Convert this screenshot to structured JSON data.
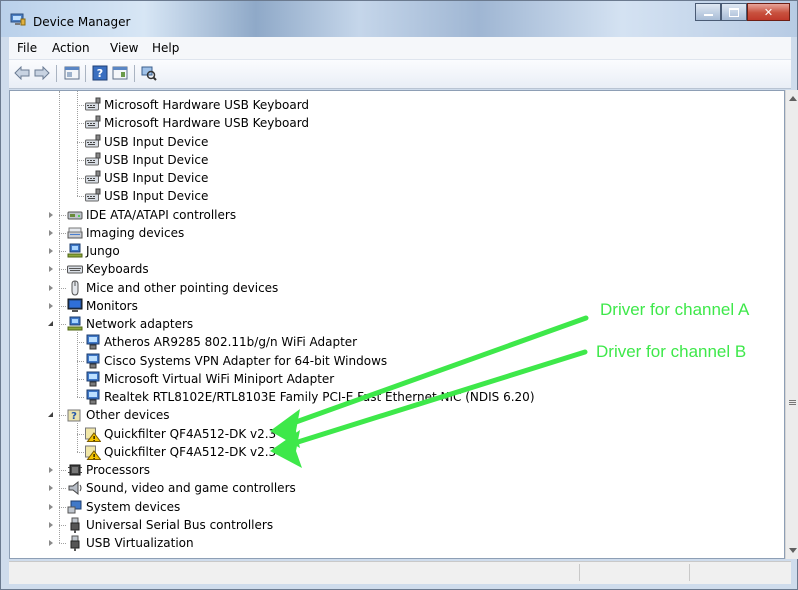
{
  "window": {
    "title": "Device Manager"
  },
  "menu": [
    "File",
    "Action",
    "View",
    "Help"
  ],
  "toolbar": {
    "buttons": [
      "back-arrow-icon",
      "forward-arrow-icon",
      "properties-icon",
      "help-icon",
      "details-icon",
      "scan-hardware-icon"
    ]
  },
  "tree": [
    {
      "label": "Microsoft Hardware USB Keyboard",
      "level": 2,
      "icon": "keyboard-device-icon"
    },
    {
      "label": "Microsoft Hardware USB Keyboard",
      "level": 2,
      "icon": "keyboard-device-icon"
    },
    {
      "label": "USB Input Device",
      "level": 2,
      "icon": "keyboard-device-icon"
    },
    {
      "label": "USB Input Device",
      "level": 2,
      "icon": "keyboard-device-icon"
    },
    {
      "label": "USB Input Device",
      "level": 2,
      "icon": "keyboard-device-icon"
    },
    {
      "label": "USB Input Device",
      "level": 2,
      "icon": "keyboard-device-icon"
    },
    {
      "label": "IDE ATA/ATAPI controllers",
      "level": 1,
      "icon": "ide-controller-icon",
      "state": "collapsed"
    },
    {
      "label": "Imaging devices",
      "level": 1,
      "icon": "scanner-icon",
      "state": "collapsed"
    },
    {
      "label": "Jungo",
      "level": 1,
      "icon": "network-computer-icon",
      "state": "collapsed"
    },
    {
      "label": "Keyboards",
      "level": 1,
      "icon": "keyboard-icon",
      "state": "collapsed"
    },
    {
      "label": "Mice and other pointing devices",
      "level": 1,
      "icon": "mouse-icon",
      "state": "collapsed"
    },
    {
      "label": "Monitors",
      "level": 1,
      "icon": "monitor-icon",
      "state": "collapsed"
    },
    {
      "label": "Network adapters",
      "level": 1,
      "icon": "network-computer-icon",
      "state": "expanded"
    },
    {
      "label": "Atheros AR9285 802.11b/g/n WiFi Adapter",
      "level": 2,
      "icon": "network-adapter-icon"
    },
    {
      "label": "Cisco Systems VPN Adapter for 64-bit Windows",
      "level": 2,
      "icon": "network-adapter-icon"
    },
    {
      "label": "Microsoft Virtual WiFi Miniport Adapter",
      "level": 2,
      "icon": "network-adapter-icon"
    },
    {
      "label": "Realtek RTL8102E/RTL8103E Family PCI-E Fast Ethernet NIC (NDIS 6.20)",
      "level": 2,
      "icon": "network-adapter-icon"
    },
    {
      "label": "Other devices",
      "level": 1,
      "icon": "unknown-device-icon",
      "state": "expanded"
    },
    {
      "label": "Quickfilter QF4A512-DK v2.3",
      "level": 2,
      "icon": "warning-device-icon"
    },
    {
      "label": "Quickfilter QF4A512-DK v2.3",
      "level": 2,
      "icon": "warning-device-icon"
    },
    {
      "label": "Processors",
      "level": 1,
      "icon": "processor-icon",
      "state": "collapsed"
    },
    {
      "label": "Sound, video and game controllers",
      "level": 1,
      "icon": "speaker-icon",
      "state": "collapsed"
    },
    {
      "label": "System devices",
      "level": 1,
      "icon": "system-device-icon",
      "state": "collapsed"
    },
    {
      "label": "Universal Serial Bus controllers",
      "level": 1,
      "icon": "usb-plug-icon",
      "state": "collapsed"
    },
    {
      "label": "USB Virtualization",
      "level": 1,
      "icon": "usb-plug-icon",
      "state": "collapsed"
    }
  ],
  "annotations": {
    "channel_a": "Driver for channel A",
    "channel_b": "Driver for channel B",
    "color": "#3ee84a"
  }
}
